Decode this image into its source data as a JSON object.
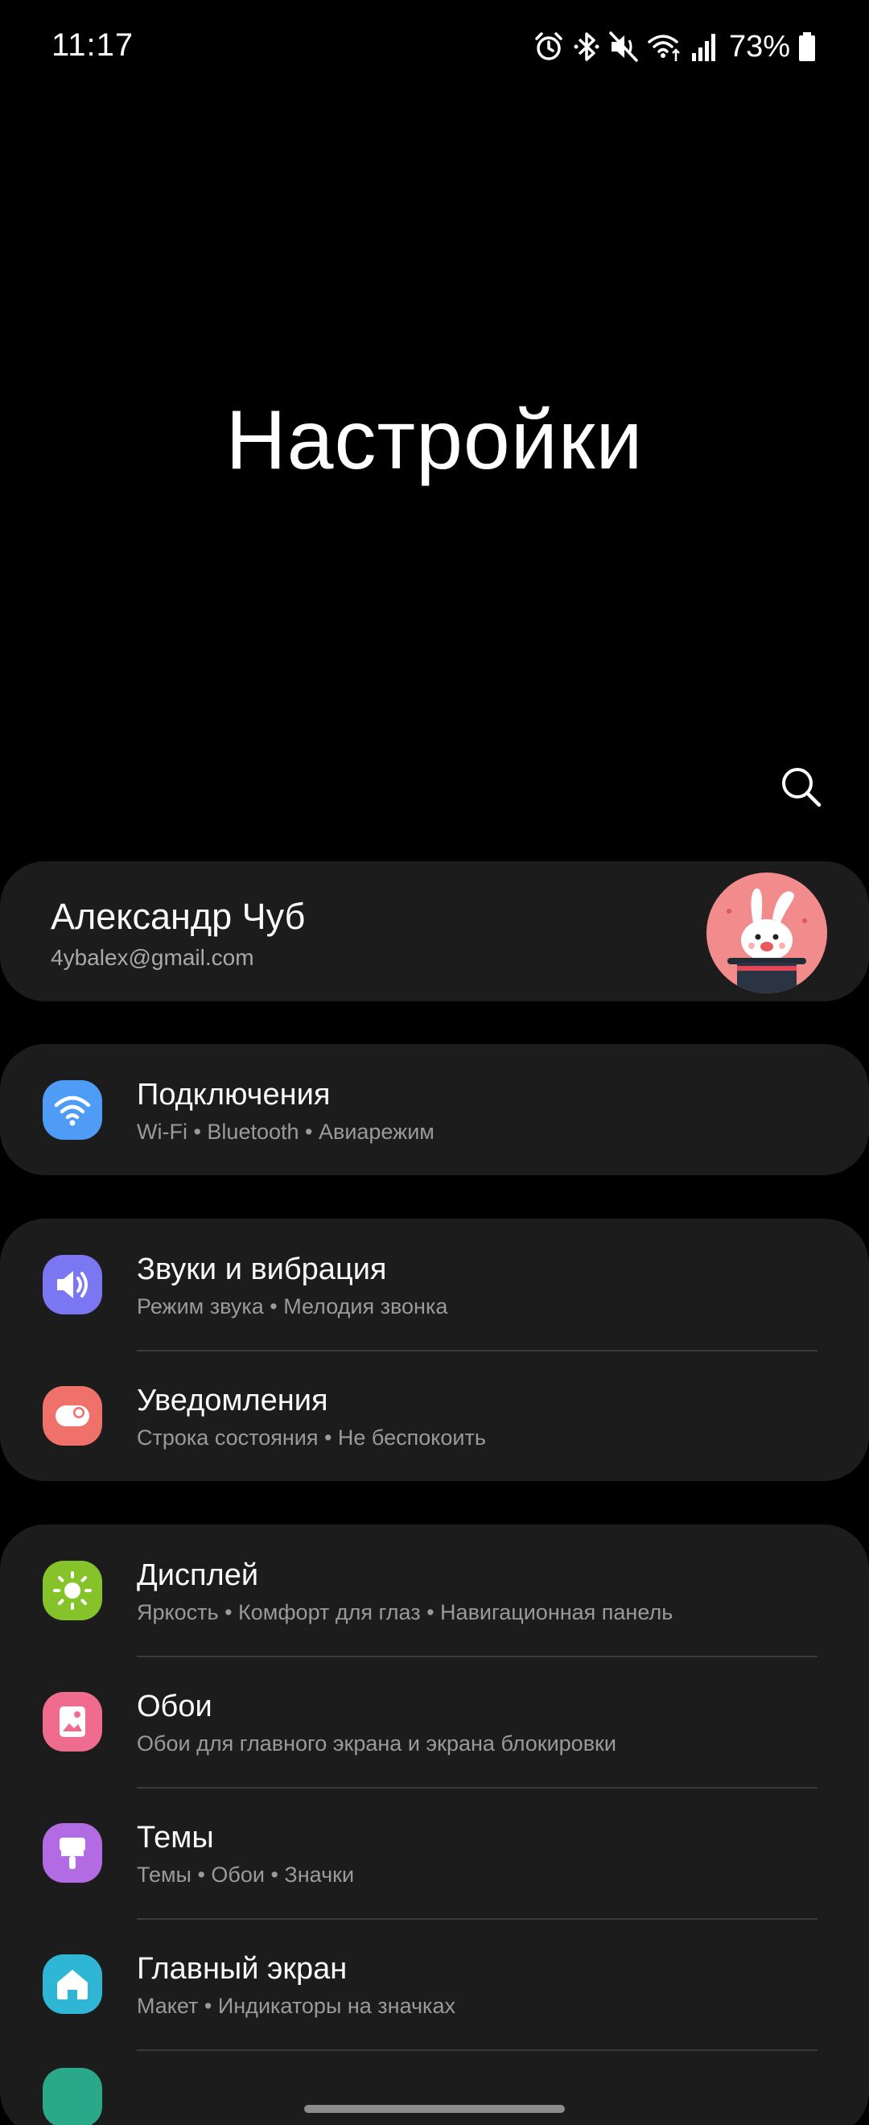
{
  "status_bar": {
    "time": "11:17",
    "battery_percent": "73%",
    "icons": [
      "alarm-icon",
      "bluetooth-icon",
      "mute-icon",
      "wifi-icon",
      "signal-icon",
      "battery-icon"
    ]
  },
  "page_title": "Настройки",
  "account": {
    "name": "Александр Чуб",
    "email": "4ybalex@gmail.com"
  },
  "groups": [
    {
      "items": [
        {
          "title": "Подключения",
          "subtitle": "Wi-Fi • Bluetooth • Авиарежим",
          "icon": "wifi-icon",
          "color": "#4f9cf7"
        }
      ]
    },
    {
      "items": [
        {
          "title": "Звуки и вибрация",
          "subtitle": "Режим звука • Мелодия звонка",
          "icon": "volume-icon",
          "color": "#7b77f2"
        },
        {
          "title": "Уведомления",
          "subtitle": "Строка состояния • Не беспокоить",
          "icon": "notification-icon",
          "color": "#f0706a"
        }
      ]
    },
    {
      "items": [
        {
          "title": "Дисплей",
          "subtitle": "Яркость • Комфорт для глаз • Навигационная панель",
          "icon": "sun-icon",
          "color": "#86c22a"
        },
        {
          "title": "Обои",
          "subtitle": "Обои для главного экрана и экрана блокировки",
          "icon": "image-icon",
          "color": "#ef6c8f"
        },
        {
          "title": "Темы",
          "subtitle": "Темы • Обои • Значки",
          "icon": "brush-icon",
          "color": "#b26be3"
        },
        {
          "title": "Главный экран",
          "subtitle": "Макет • Индикаторы на значках",
          "icon": "home-icon",
          "color": "#2eb6d4"
        }
      ]
    }
  ],
  "colors": {
    "background": "#000000",
    "card": "#1c1c1c",
    "subtitle": "#9a9a9a",
    "divider": "#3a3a3a"
  }
}
